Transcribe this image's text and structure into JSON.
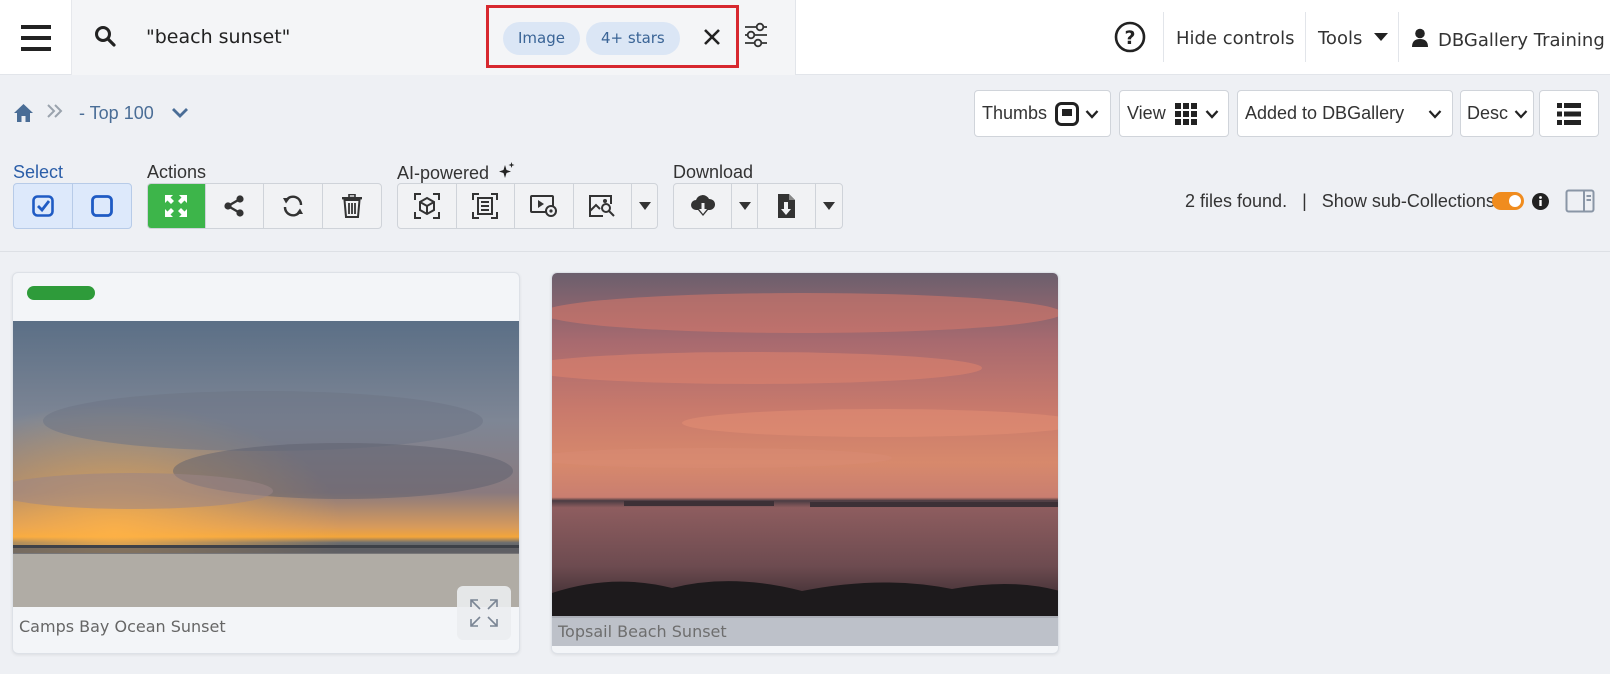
{
  "search": {
    "query": "\"beach sunset\""
  },
  "filters": {
    "chips": [
      "Image",
      "4+ stars"
    ]
  },
  "topnav": {
    "hide_controls": "Hide controls",
    "tools": "Tools",
    "user": "DBGallery Training"
  },
  "breadcrumb": {
    "current": "- Top 100"
  },
  "view_controls": {
    "thumbs": "Thumbs",
    "view": "View",
    "sort_field": "Added to DBGallery",
    "sort_order": "Desc"
  },
  "toolbar": {
    "select_label": "Select",
    "actions_label": "Actions",
    "ai_label": "AI-powered",
    "download_label": "Download"
  },
  "status": {
    "files_found": "2 files found.",
    "separator": "|",
    "show_sub": "Show sub-Collections",
    "show_sub_enabled": true
  },
  "results": [
    {
      "title": "Camps Bay Ocean Sunset",
      "rating_badge_color": "#2e9b3a"
    },
    {
      "title": "Topsail Beach Sunset"
    }
  ],
  "colors": {
    "accent": "#4a6d96",
    "highlight_border": "#d7282f",
    "toggle": "#f08c1e",
    "actions_primary": "#3db54a"
  }
}
